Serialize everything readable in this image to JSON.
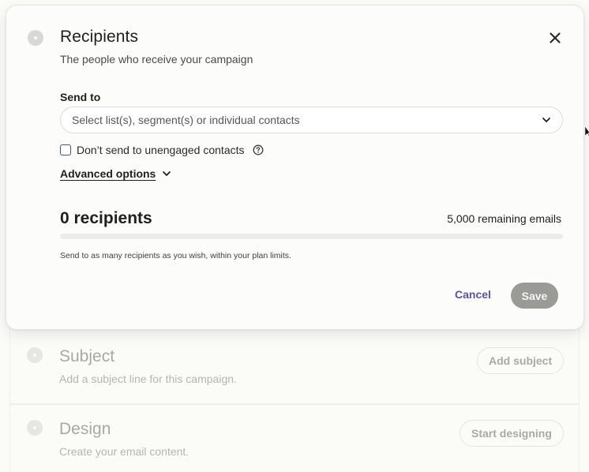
{
  "recipients": {
    "title": "Recipients",
    "subtitle": "The people who receive your campaign",
    "send_to_label": "Send to",
    "select_placeholder": "Select list(s), segment(s) or individual contacts",
    "unengaged_checkbox_label": "Don’t send to unengaged contacts",
    "unengaged_checked": false,
    "advanced_options_label": "Advanced options",
    "recipient_count": "0 recipients",
    "remaining_emails": "5,000 remaining emails",
    "progress_fraction": 0,
    "hint": "Send to as many recipients as you wish, within your plan limits.",
    "cancel_label": "Cancel",
    "save_label": "Save"
  },
  "subject": {
    "title": "Subject",
    "description": "Add a subject line for this campaign.",
    "button_label": "Add subject"
  },
  "design": {
    "title": "Design",
    "description": "Create your email content.",
    "button_label": "Start designing"
  },
  "colors": {
    "accent": "#5a4fb8",
    "save_disabled": "#9a9a97"
  },
  "icons": {
    "close": "close-icon",
    "select_chevron": "chevron-down-icon",
    "help": "question-circle-icon",
    "advanced_chevron": "chevron-down-icon"
  }
}
